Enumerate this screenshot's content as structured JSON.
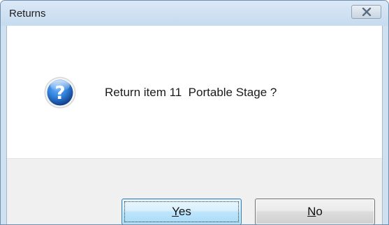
{
  "window": {
    "title": "Returns"
  },
  "dialog": {
    "message": "Return item 11  Portable Stage ?",
    "icon": "question-icon"
  },
  "buttons": {
    "yes": {
      "mnemonic": "Y",
      "rest": "es"
    },
    "no": {
      "mnemonic": "N",
      "rest": "o"
    }
  },
  "colors": {
    "titlebar": "#c6dbef",
    "icon_blue": "#1c5fb5",
    "default_button": "#bee6fd",
    "button_area": "#f0f0f0"
  }
}
